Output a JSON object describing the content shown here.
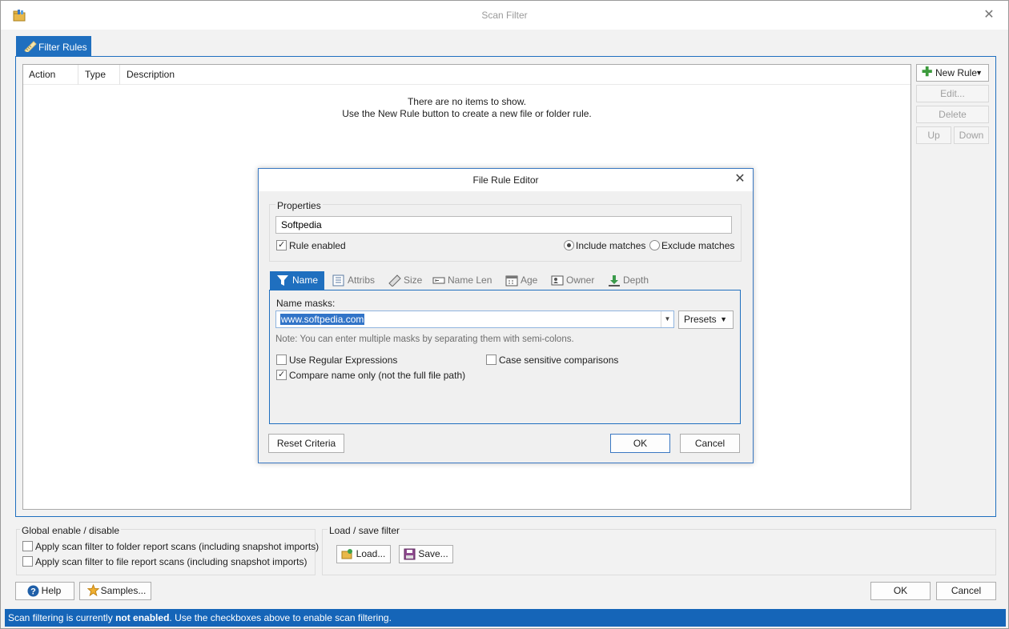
{
  "window": {
    "title": "Scan Filter",
    "close_glyph": "✕"
  },
  "main_tab": {
    "label": "Filter Rules"
  },
  "rules_list": {
    "columns": [
      "Action",
      "Type",
      "Description"
    ],
    "empty_line1": "There are no items to show.",
    "empty_line2": "Use the New Rule button to create a new file or folder rule."
  },
  "side_buttons": {
    "new_rule": "New Rule",
    "edit": "Edit...",
    "delete": "Delete",
    "up": "Up",
    "down": "Down"
  },
  "global_group": {
    "title": "Global enable / disable",
    "folder_scans": "Apply scan filter to folder report scans (including snapshot imports)",
    "file_scans": "Apply scan filter to file report scans (including snapshot imports)",
    "folder_checked": false,
    "file_checked": false
  },
  "load_save_group": {
    "title": "Load / save filter",
    "load": "Load...",
    "save": "Save..."
  },
  "bottom_buttons": {
    "help": "Help",
    "samples": "Samples...",
    "ok": "OK",
    "cancel": "Cancel"
  },
  "status": {
    "prefix": "Scan filtering is currently ",
    "emphasis": "not enabled",
    "suffix": ". Use the checkboxes above to enable scan filtering."
  },
  "dialog": {
    "title": "File Rule Editor",
    "close_glyph": "✕",
    "properties_title": "Properties",
    "rule_name": "Softpedia",
    "rule_enabled": "Rule enabled",
    "rule_enabled_checked": true,
    "include_matches": "Include matches",
    "exclude_matches": "Exclude matches",
    "selected_match_mode": "include",
    "tabs": {
      "name": "Name",
      "attribs": "Attribs",
      "size": "Size",
      "name_len": "Name Len",
      "age": "Age",
      "owner": "Owner",
      "depth": "Depth"
    },
    "active_tab": "Name",
    "name_masks_label": "Name masks:",
    "name_mask_value": "www.softpedia.com",
    "presets": "Presets",
    "note": "Note: You can enter multiple masks by separating them with semi-colons.",
    "use_regex": "Use Regular Expressions",
    "use_regex_checked": false,
    "case_sensitive": "Case sensitive comparisons",
    "case_sensitive_checked": false,
    "compare_name_only": "Compare name only (not the full file path)",
    "compare_name_only_checked": true,
    "reset_criteria": "Reset Criteria",
    "ok": "OK",
    "cancel": "Cancel"
  },
  "colors": {
    "accent": "#1f6fbf",
    "status_bar": "#1565b8",
    "selection": "#3174c8"
  }
}
